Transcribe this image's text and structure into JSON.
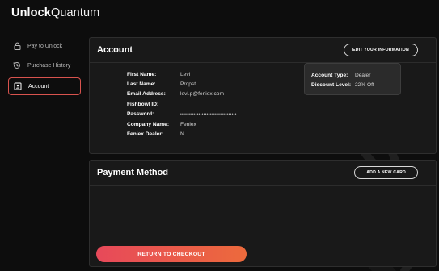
{
  "brand": {
    "bold_part": "Unlock",
    "regular_part": "Quantum"
  },
  "sidebar": {
    "items": [
      {
        "label": "Pay to Unlock",
        "icon": "lock-icon",
        "active": false
      },
      {
        "label": "Purchase History",
        "icon": "history-icon",
        "active": false
      },
      {
        "label": "Account",
        "icon": "account-card-icon",
        "active": true
      }
    ]
  },
  "account": {
    "title": "Account",
    "edit_button": "EDIT YOUR INFORMATION",
    "fields": [
      {
        "label": "First Name:",
        "value": "Levi"
      },
      {
        "label": "Last Name:",
        "value": "Propst"
      },
      {
        "label": "Email Address:",
        "value": "levi.p@feniex.com"
      },
      {
        "label": "Fishbowl ID:",
        "value": ""
      },
      {
        "label": "Password:",
        "value": "••••••••••••••••••••••••••••••••••"
      },
      {
        "label": "Company Name:",
        "value": "Feniex"
      },
      {
        "label": "Feniex Dealer:",
        "value": "N"
      }
    ],
    "type_box": {
      "type_label": "Account Type:",
      "type_value": "Dealer",
      "discount_label": "Discount Level:",
      "discount_value": "22% Off"
    }
  },
  "payment": {
    "title": "Payment Method",
    "add_button": "ADD A NEW CARD"
  },
  "checkout_button": "RETURN TO CHECKOUT",
  "colors": {
    "background": "#0d0d0d",
    "panel": "#191919",
    "accent_start": "#e7495a",
    "accent_end": "#ec6a3c",
    "active_border": "#d8534e"
  }
}
